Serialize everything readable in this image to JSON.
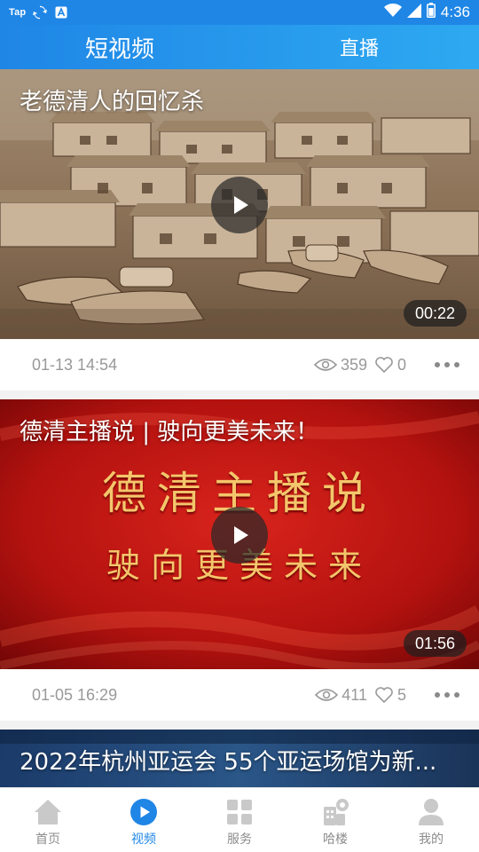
{
  "status_bar": {
    "app_label": "Tap",
    "time": "4:36",
    "icons": [
      "sync-icon",
      "a-badge-icon",
      "wifi-icon",
      "signal-icon",
      "battery-icon"
    ]
  },
  "tabs": [
    {
      "label": "短视频",
      "active": true
    },
    {
      "label": "直播",
      "active": false
    }
  ],
  "videos": [
    {
      "title": "老德清人的回忆杀",
      "duration": "00:22",
      "date": "01-13 14:54",
      "views": "359",
      "likes": "0"
    },
    {
      "title": "德清主播说 | 驶向更美未来！",
      "duration": "01:56",
      "date": "01-05 16:29",
      "views": "411",
      "likes": "5",
      "banner_line1": "德清主播说",
      "banner_line2": "驶向更美未来"
    },
    {
      "title": "2022年杭州亚运会 55个亚运场馆为新..."
    }
  ],
  "bottom_nav": [
    {
      "label": "首页",
      "icon": "home-icon",
      "active": false
    },
    {
      "label": "视频",
      "icon": "play-circle-icon",
      "active": true
    },
    {
      "label": "服务",
      "icon": "grid-icon",
      "active": false
    },
    {
      "label": "哈楼",
      "icon": "building-chat-icon",
      "active": false
    },
    {
      "label": "我的",
      "icon": "user-icon",
      "active": false
    }
  ],
  "colors": {
    "brand_blue": "#1f86e6",
    "active_nav": "#1f86e6",
    "meta_gray": "#999999"
  }
}
